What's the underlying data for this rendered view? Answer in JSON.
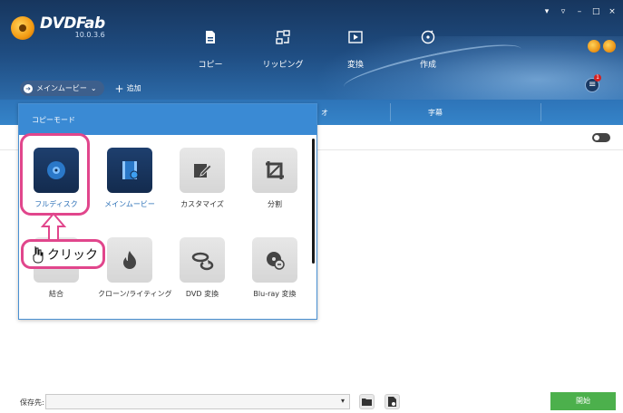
{
  "app": {
    "name": "DVDFab",
    "version": "10.0.3.6",
    "window_controls": [
      "▾",
      "▿",
      "–",
      "□",
      "×"
    ]
  },
  "nav": [
    {
      "label": "コピー",
      "icon": "file-icon"
    },
    {
      "label": "リッピング",
      "icon": "rip-icon"
    },
    {
      "label": "変換",
      "icon": "play-icon"
    },
    {
      "label": "作成",
      "icon": "disc-create-icon"
    }
  ],
  "menu_badge": "1",
  "tabs": {
    "main": "メインムービー",
    "add": "追加"
  },
  "columns": [
    "オ",
    "字幕"
  ],
  "popup": {
    "title": "コピーモード",
    "modes": [
      {
        "label": "フルディスク",
        "icon": "disc-icon"
      },
      {
        "label": "メインムービー",
        "icon": "film-icon"
      },
      {
        "label": "カスタマイズ",
        "icon": "edit-icon"
      },
      {
        "label": "分割",
        "icon": "crop-icon"
      },
      {
        "label": "結合",
        "icon": "merge-icon"
      },
      {
        "label": "クローン/ライティング",
        "icon": "flame-icon"
      },
      {
        "label": "DVD 変換",
        "icon": "dvd-convert-icon"
      },
      {
        "label": "Blu-ray 変換",
        "icon": "bluray-convert-icon"
      }
    ]
  },
  "annotation": {
    "click_text": "クリック"
  },
  "bottom": {
    "save_label": "保存先:",
    "save_value": "",
    "start_label": "開始"
  },
  "colors": {
    "accent": "#3a8ad4",
    "highlight": "#e1468c",
    "start": "#4cb04c"
  }
}
